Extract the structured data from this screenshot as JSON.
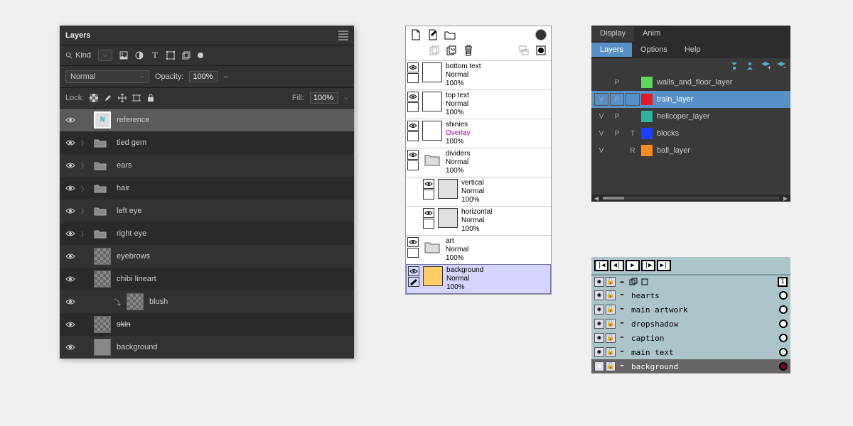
{
  "ps": {
    "title": "Layers",
    "filter_label": "Kind",
    "blend_mode": "Normal",
    "opacity_label": "Opacity:",
    "opacity_value": "100%",
    "lock_label": "Lock:",
    "fill_label": "Fill:",
    "fill_value": "100%",
    "layers": [
      {
        "name": "reference",
        "type": "ref",
        "selected": true
      },
      {
        "name": "tied gem",
        "type": "folder"
      },
      {
        "name": "ears",
        "type": "folder"
      },
      {
        "name": "hair",
        "type": "folder"
      },
      {
        "name": "left eye",
        "type": "folder"
      },
      {
        "name": "right eye",
        "type": "folder"
      },
      {
        "name": "eyebrows",
        "type": "check"
      },
      {
        "name": "chibi lineart",
        "type": "check"
      },
      {
        "name": "blush",
        "type": "check",
        "indent": true,
        "clip": true
      },
      {
        "name": "skin",
        "type": "check",
        "strike": true
      },
      {
        "name": "background",
        "type": "gray"
      }
    ]
  },
  "gimp": {
    "layers": [
      {
        "name": "bottom text",
        "blend": "Normal",
        "opacity": "100%",
        "thumb": "white"
      },
      {
        "name": "top text",
        "blend": "Normal",
        "opacity": "100%",
        "thumb": "white"
      },
      {
        "name": "shinies",
        "blend": "Overlay",
        "opacity": "100%",
        "thumb": "white"
      },
      {
        "name": "dividers",
        "blend": "Normal",
        "opacity": "100%",
        "thumb": "folder"
      },
      {
        "name": "vertical",
        "blend": "Normal",
        "opacity": "100%",
        "thumb": "gray",
        "indent": true
      },
      {
        "name": "horizontal",
        "blend": "Normal",
        "opacity": "100%",
        "thumb": "gray",
        "indent": true
      },
      {
        "name": "art",
        "blend": "Normal",
        "opacity": "100%",
        "thumb": "folder"
      },
      {
        "name": "background",
        "blend": "Normal",
        "opacity": "100%",
        "thumb": "bg",
        "selected": true
      }
    ]
  },
  "bl": {
    "tab1": "Display",
    "tab2": "Anim",
    "subtab1": "Layers",
    "subtab2": "Options",
    "subtab3": "Help",
    "layers": [
      {
        "v": "",
        "p": "P",
        "t": "",
        "color": "#5bd75b",
        "name": "walls_and_floor_layer"
      },
      {
        "v": "V",
        "p": "P",
        "t": "",
        "color": "#e01b24",
        "name": "train_layer",
        "selected": true
      },
      {
        "v": "V",
        "p": "P",
        "t": "",
        "color": "#2bb5a0",
        "name": "helicoper_layer"
      },
      {
        "v": "V",
        "p": "P",
        "t": "T",
        "color": "#1a3fff",
        "name": "blocks"
      },
      {
        "v": "V",
        "p": "",
        "t": "R",
        "color": "#ff8c1a",
        "name": "ball_layer"
      }
    ]
  },
  "px": {
    "frame_label": "1",
    "layers": [
      {
        "name": "hearts"
      },
      {
        "name": "main artwork"
      },
      {
        "name": "dropshadow"
      },
      {
        "name": "caption"
      },
      {
        "name": "main text"
      },
      {
        "name": "background",
        "selected": true,
        "dot_filled": true
      }
    ]
  }
}
